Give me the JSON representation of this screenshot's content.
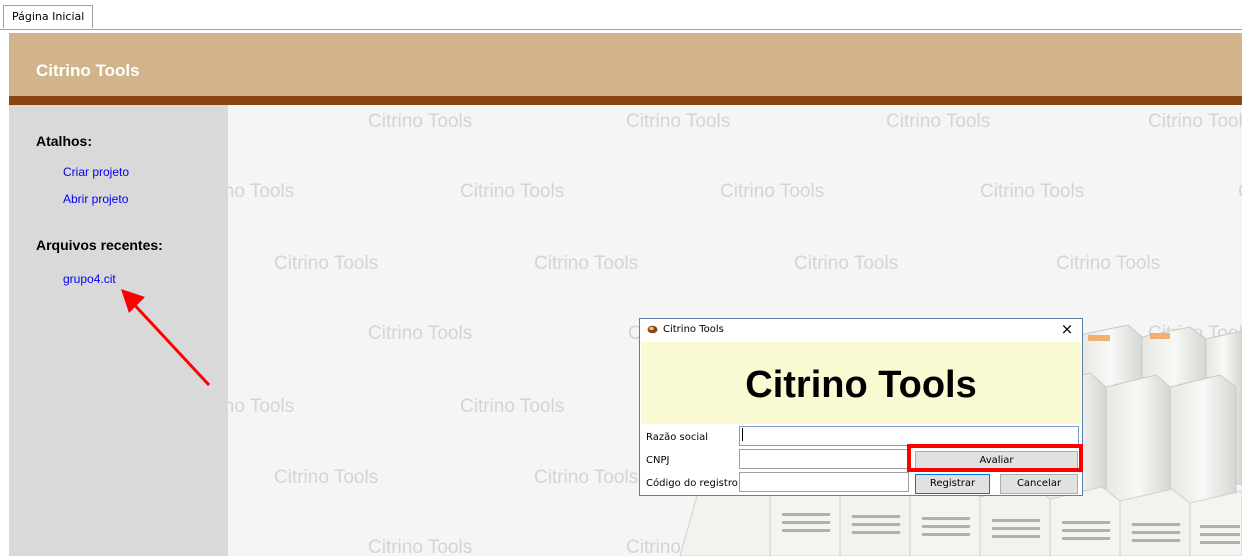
{
  "tabs": [
    {
      "label": "Página Inicial"
    }
  ],
  "header": {
    "title": "Citrino Tools"
  },
  "sidebar": {
    "shortcuts_heading": "Atalhos:",
    "shortcuts": [
      {
        "label": "Criar projeto"
      },
      {
        "label": "Abrir projeto"
      }
    ],
    "recent_heading": "Arquivos recentes:",
    "recent": [
      {
        "label": "grupo4.cit"
      }
    ]
  },
  "watermark": {
    "text": "Citrino Tools"
  },
  "dialog": {
    "title": "Citrino Tools",
    "close": "×",
    "banner": "Citrino Tools",
    "fields": [
      {
        "label": "Razão social",
        "value": ""
      },
      {
        "label": "CNPJ",
        "value": ""
      },
      {
        "label": "Código do registro",
        "value": ""
      }
    ],
    "buttons": {
      "evaluate": "Avaliar",
      "register": "Registrar",
      "cancel": "Cancelar"
    }
  },
  "colors": {
    "header_bg": "#d2b48c",
    "header_line": "#8b4513",
    "sidebar_bg": "#d9d9d9",
    "link": "#0000ee",
    "banner_bg": "#fafad2",
    "annotation": "#ff0000"
  }
}
